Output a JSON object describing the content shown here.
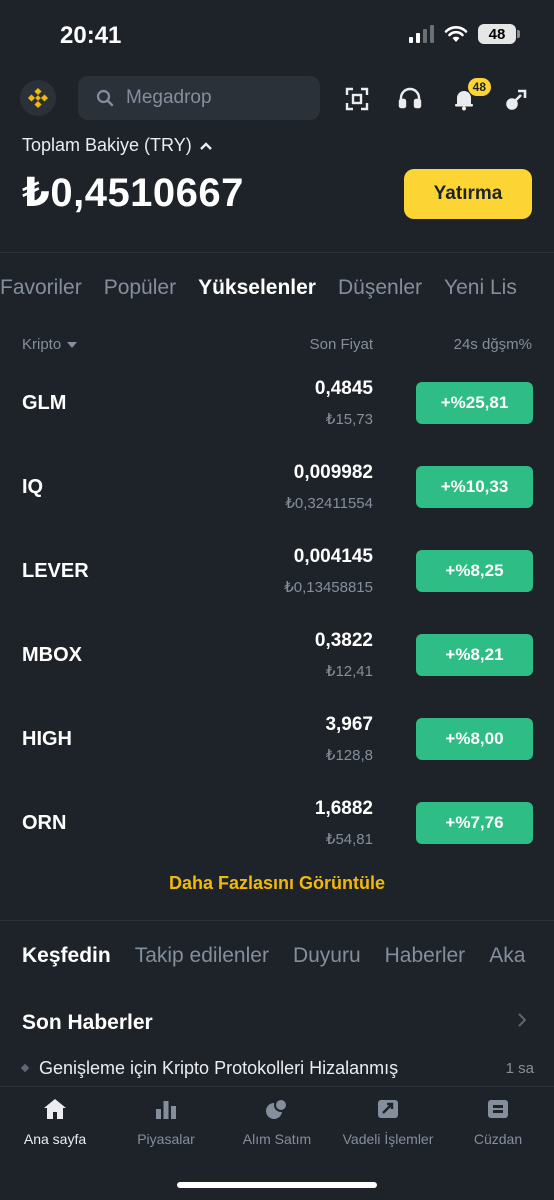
{
  "status_bar": {
    "time": "20:41",
    "battery": "48"
  },
  "search": {
    "placeholder": "Megadrop"
  },
  "notifications": {
    "count": "48"
  },
  "balance": {
    "label": "Toplam Bakiye (TRY)",
    "value": "₺0,4510667",
    "deposit_label": "Yatırma"
  },
  "market_tabs": [
    "Favoriler",
    "Popüler",
    "Yükselenler",
    "Düşenler",
    "Yeni Lis"
  ],
  "market_tabs_active": "Yükselenler",
  "columns": {
    "crypto": "Kripto",
    "last_price": "Son Fiyat",
    "change": "24s dğşm%"
  },
  "rows": [
    {
      "symbol": "GLM",
      "price": "0,4845",
      "price_try": "₺15,73",
      "change": "+%25,81"
    },
    {
      "symbol": "IQ",
      "price": "0,009982",
      "price_try": "₺0,32411554",
      "change": "+%10,33"
    },
    {
      "symbol": "LEVER",
      "price": "0,004145",
      "price_try": "₺0,13458815",
      "change": "+%8,25"
    },
    {
      "symbol": "MBOX",
      "price": "0,3822",
      "price_try": "₺12,41",
      "change": "+%8,21"
    },
    {
      "symbol": "HIGH",
      "price": "3,967",
      "price_try": "₺128,8",
      "change": "+%8,00"
    },
    {
      "symbol": "ORN",
      "price": "1,6882",
      "price_try": "₺54,81",
      "change": "+%7,76"
    }
  ],
  "more_link": "Daha Fazlasını Görüntüle",
  "discover_tabs": [
    "Keşfedin",
    "Takip edilenler",
    "Duyuru",
    "Haberler",
    "Aka"
  ],
  "news": {
    "title": "Son Haberler",
    "item_text": "Genişleme için Kripto Protokolleri Hizalanmış",
    "item_time": "1 sa"
  },
  "bottom_nav": [
    {
      "label": "Ana sayfa",
      "icon": "home-icon"
    },
    {
      "label": "Piyasalar",
      "icon": "markets-icon"
    },
    {
      "label": "Alım Satım",
      "icon": "trade-icon"
    },
    {
      "label": "Vadeli İşlemler",
      "icon": "futures-icon"
    },
    {
      "label": "Cüzdan",
      "icon": "wallet-icon"
    }
  ],
  "colors": {
    "accent": "#fcd535",
    "positive": "#2ebd85",
    "background": "#1e2329"
  }
}
